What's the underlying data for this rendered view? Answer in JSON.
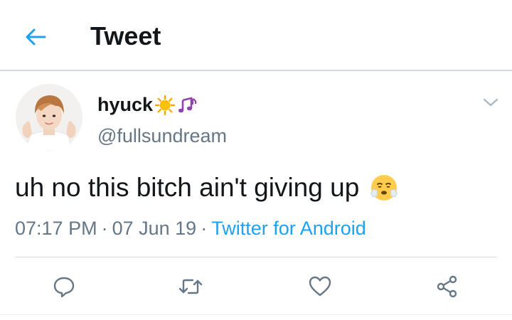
{
  "header": {
    "title": "Tweet",
    "back_icon": "arrow-left-icon",
    "accent": "#1da1f2"
  },
  "author": {
    "display_name": "hyuck",
    "name_emojis": [
      "sun-emoji",
      "musical-notes-emoji"
    ],
    "handle": "@fullsundream",
    "avatar": "profile-photo"
  },
  "tweet": {
    "text": "uh no this bitch ain't giving up",
    "emoji": "face-with-steam-from-nose-emoji",
    "time": "07:17 PM",
    "date": "07 Jun 19",
    "client": "Twitter for Android"
  },
  "actions": [
    "reply-icon",
    "retweet-icon",
    "like-icon",
    "share-icon"
  ],
  "colors": {
    "text": "#14171a",
    "muted": "#657786",
    "link": "#1da1f2",
    "border": "#d6d9dc"
  }
}
